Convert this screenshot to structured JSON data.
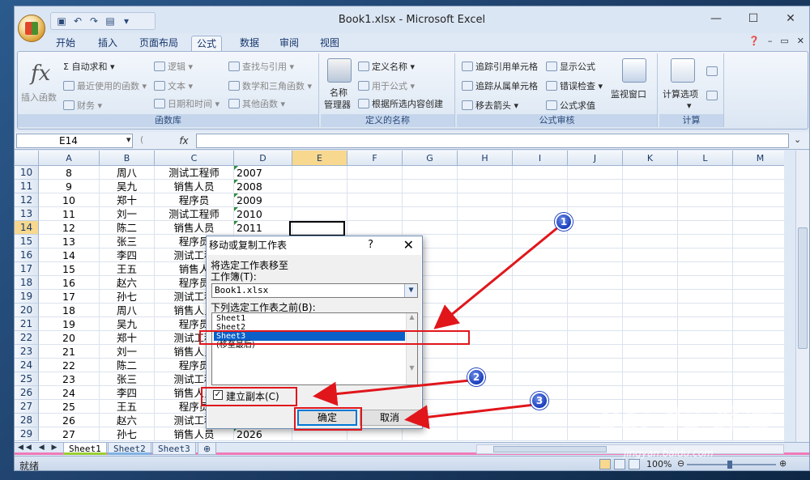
{
  "window": {
    "title": "Book1.xlsx - Microsoft Excel",
    "controls": [
      "—",
      "☐",
      "✕"
    ]
  },
  "ribbon_tabs": [
    "开始",
    "插入",
    "页面布局",
    "公式",
    "数据",
    "审阅",
    "视图"
  ],
  "active_tab": "公式",
  "ribbon": {
    "func_lib": {
      "insert_function": "插入函数",
      "autosum": "Σ 自动求和 ▾",
      "recent": "最近使用的函数 ▾",
      "financial": "财务 ▾",
      "logical": "逻辑 ▾",
      "text": "文本 ▾",
      "datetime": "日期和时间 ▾",
      "lookup": "查找与引用 ▾",
      "math": "数学和三角函数 ▾",
      "more": "其他函数 ▾",
      "label": "函数库"
    },
    "defined_names": {
      "name_manager_1": "名称",
      "name_manager_2": "管理器",
      "define_name": "定义名称 ▾",
      "use_in_formula": "用于公式 ▾",
      "create_from_sel": "根据所选内容创建",
      "label": "定义的名称"
    },
    "auditing": {
      "trace_precedents": "追踪引用单元格",
      "trace_dependents": "追踪从属单元格",
      "remove_arrows": "移去箭头 ▾",
      "show_formulas": "显示公式",
      "error_check": "错误检查 ▾",
      "evaluate": "公式求值",
      "watch": "监视窗口",
      "label": "公式审核"
    },
    "calc": {
      "options": "计算选项",
      "label": "计算"
    }
  },
  "formula_bar": {
    "name_box": "E14",
    "fx": "fx",
    "formula": ""
  },
  "columns": [
    "A",
    "B",
    "C",
    "D",
    "E",
    "F",
    "G",
    "H",
    "I",
    "J",
    "K",
    "L",
    "M"
  ],
  "rows": [
    {
      "n": "10",
      "a": "8",
      "b": "周八",
      "c": "测试工程师",
      "d": "2007"
    },
    {
      "n": "11",
      "a": "9",
      "b": "吴九",
      "c": "销售人员",
      "d": "2008"
    },
    {
      "n": "12",
      "a": "10",
      "b": "郑十",
      "c": "程序员",
      "d": "2009"
    },
    {
      "n": "13",
      "a": "11",
      "b": "刘一",
      "c": "测试工程师",
      "d": "2010"
    },
    {
      "n": "14",
      "a": "12",
      "b": "陈二",
      "c": "销售人员",
      "d": "2011"
    },
    {
      "n": "15",
      "a": "13",
      "b": "张三",
      "c": "程序员",
      "d": ""
    },
    {
      "n": "16",
      "a": "14",
      "b": "李四",
      "c": "测试工程",
      "d": ""
    },
    {
      "n": "17",
      "a": "15",
      "b": "王五",
      "c": "销售人",
      "d": ""
    },
    {
      "n": "18",
      "a": "16",
      "b": "赵六",
      "c": "程序员",
      "d": ""
    },
    {
      "n": "19",
      "a": "17",
      "b": "孙七",
      "c": "测试工程",
      "d": ""
    },
    {
      "n": "20",
      "a": "18",
      "b": "周八",
      "c": "销售人员",
      "d": ""
    },
    {
      "n": "21",
      "a": "19",
      "b": "吴九",
      "c": "程序员",
      "d": ""
    },
    {
      "n": "22",
      "a": "20",
      "b": "郑十",
      "c": "测试工程",
      "d": ""
    },
    {
      "n": "23",
      "a": "21",
      "b": "刘一",
      "c": "销售人员",
      "d": ""
    },
    {
      "n": "24",
      "a": "22",
      "b": "陈二",
      "c": "程序员",
      "d": ""
    },
    {
      "n": "25",
      "a": "23",
      "b": "张三",
      "c": "测试工程",
      "d": ""
    },
    {
      "n": "26",
      "a": "24",
      "b": "李四",
      "c": "销售人员",
      "d": ""
    },
    {
      "n": "27",
      "a": "25",
      "b": "王五",
      "c": "程序员",
      "d": ""
    },
    {
      "n": "28",
      "a": "26",
      "b": "赵六",
      "c": "测试工程",
      "d": ""
    },
    {
      "n": "29",
      "a": "27",
      "b": "孙七",
      "c": "销售人员",
      "d": "2026"
    }
  ],
  "selected_row": "14",
  "sheet_tabs": [
    "Sheet1",
    "Sheet2",
    "Sheet3"
  ],
  "sheet_colors": [
    "#f07ab8",
    "#9acd32",
    "#7fb2e5"
  ],
  "status": {
    "ready": "就绪",
    "zoom": "100%"
  },
  "dialog": {
    "title": "移动或复制工作表",
    "help": "?",
    "close": "✕",
    "move_label": "将选定工作表移至",
    "workbook_label": "工作簿(T):",
    "workbook_value": "Book1.xlsx",
    "before_label": "下列选定工作表之前(B):",
    "list": [
      "Sheet1",
      "Sheet2",
      "Sheet3",
      "(移至最后)"
    ],
    "selected_item": "Sheet3",
    "copy_label": "建立副本(C)",
    "copy_checked": "✓",
    "ok": "确定",
    "cancel": "取消"
  },
  "annotations": {
    "badges": [
      "1",
      "2",
      "3"
    ],
    "color": "#e0161b"
  },
  "watermark": {
    "brand": "Bai du 经验",
    "url": "jingyan.baidu.com"
  }
}
